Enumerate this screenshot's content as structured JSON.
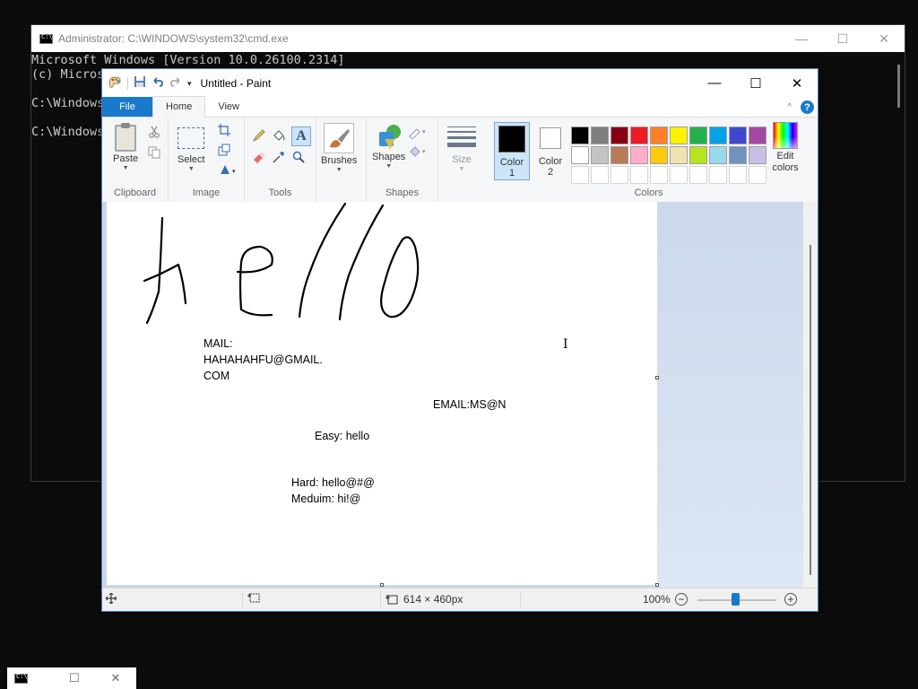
{
  "cmd": {
    "title": "Administrator: C:\\WINDOWS\\system32\\cmd.exe",
    "lines": [
      "Microsoft Windows [Version 10.0.26100.2314]",
      "(c) Micros",
      "",
      "C:\\Windows",
      "",
      "C:\\Windows"
    ],
    "icon": "console-icon"
  },
  "paint": {
    "title": "Untitled - Paint",
    "tabs": {
      "file": "File",
      "home": "Home",
      "view": "View"
    },
    "ribbon": {
      "clipboard": {
        "label": "Clipboard",
        "paste": "Paste"
      },
      "image": {
        "label": "Image",
        "select": "Select"
      },
      "tools": {
        "label": "Tools"
      },
      "brushes": {
        "label": "Brushes"
      },
      "shapes": {
        "label": "Shapes",
        "button": "Shapes"
      },
      "size": {
        "label": "Size"
      },
      "colors": {
        "label": "Colors",
        "color1": "Color",
        "color1_num": "1",
        "color2": "Color",
        "color2_num": "2",
        "color1_value": "#000000",
        "color2_value": "#ffffff",
        "edit": "Edit",
        "edit2": "colors",
        "palette_row1": [
          "#000000",
          "#7f7f7f",
          "#880015",
          "#ed1c24",
          "#ff7f27",
          "#fff200",
          "#22b14c",
          "#00a2e8",
          "#3f48cc",
          "#a349a4"
        ],
        "palette_row2": [
          "#ffffff",
          "#c3c3c3",
          "#b97a57",
          "#ffaec9",
          "#ffc90e",
          "#efe4b0",
          "#b5e61d",
          "#99d9ea",
          "#7092be",
          "#c8bfe7"
        ]
      }
    },
    "canvas": {
      "drawn_word": "hello",
      "mail_line1": "MAIL:",
      "mail_line2": "HAHAHAHFU@GMAIL.",
      "mail_line3": "COM",
      "email": "EMAIL:MS@N",
      "easy": "Easy: hello",
      "hard": "Hard: hello@#@",
      "medium": "Meduim: hi!@"
    },
    "status": {
      "size": "614 × 460px",
      "zoom": "100%",
      "zoom_level": 100
    }
  },
  "taskbar": {
    "icon": "console-icon"
  }
}
